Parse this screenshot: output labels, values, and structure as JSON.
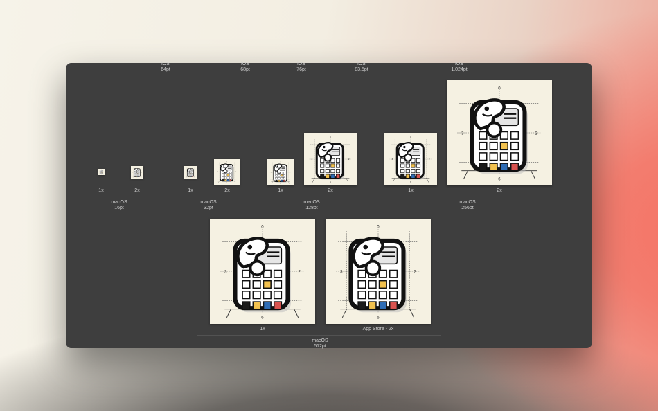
{
  "ios_labels": [
    {
      "platform": "iOS",
      "size": "64pt"
    },
    {
      "platform": "iOS",
      "size": "68pt"
    },
    {
      "platform": "iOS",
      "size": "76pt"
    },
    {
      "platform": "iOS",
      "size": "83.5pt"
    },
    {
      "platform": "iOS",
      "size": "1,024pt"
    }
  ],
  "scales": {
    "one": "1x",
    "two": "2x",
    "app_store": "App Store - 2x"
  },
  "macos_groups": [
    {
      "platform": "macOS",
      "size": "16pt"
    },
    {
      "platform": "macOS",
      "size": "32pt"
    },
    {
      "platform": "macOS",
      "size": "128pt"
    },
    {
      "platform": "macOS",
      "size": "256pt"
    },
    {
      "platform": "macOS",
      "size": "512pt"
    }
  ],
  "icon": {
    "name": "app-icon",
    "guide_numbers": [
      "0",
      "2",
      "3",
      "6"
    ],
    "colors": {
      "background": "#f5f1e2",
      "outline": "#111111",
      "yellow": "#f2c14e",
      "blue": "#2f6db5",
      "red": "#d9534f",
      "dark": "#1b1b1b"
    }
  }
}
